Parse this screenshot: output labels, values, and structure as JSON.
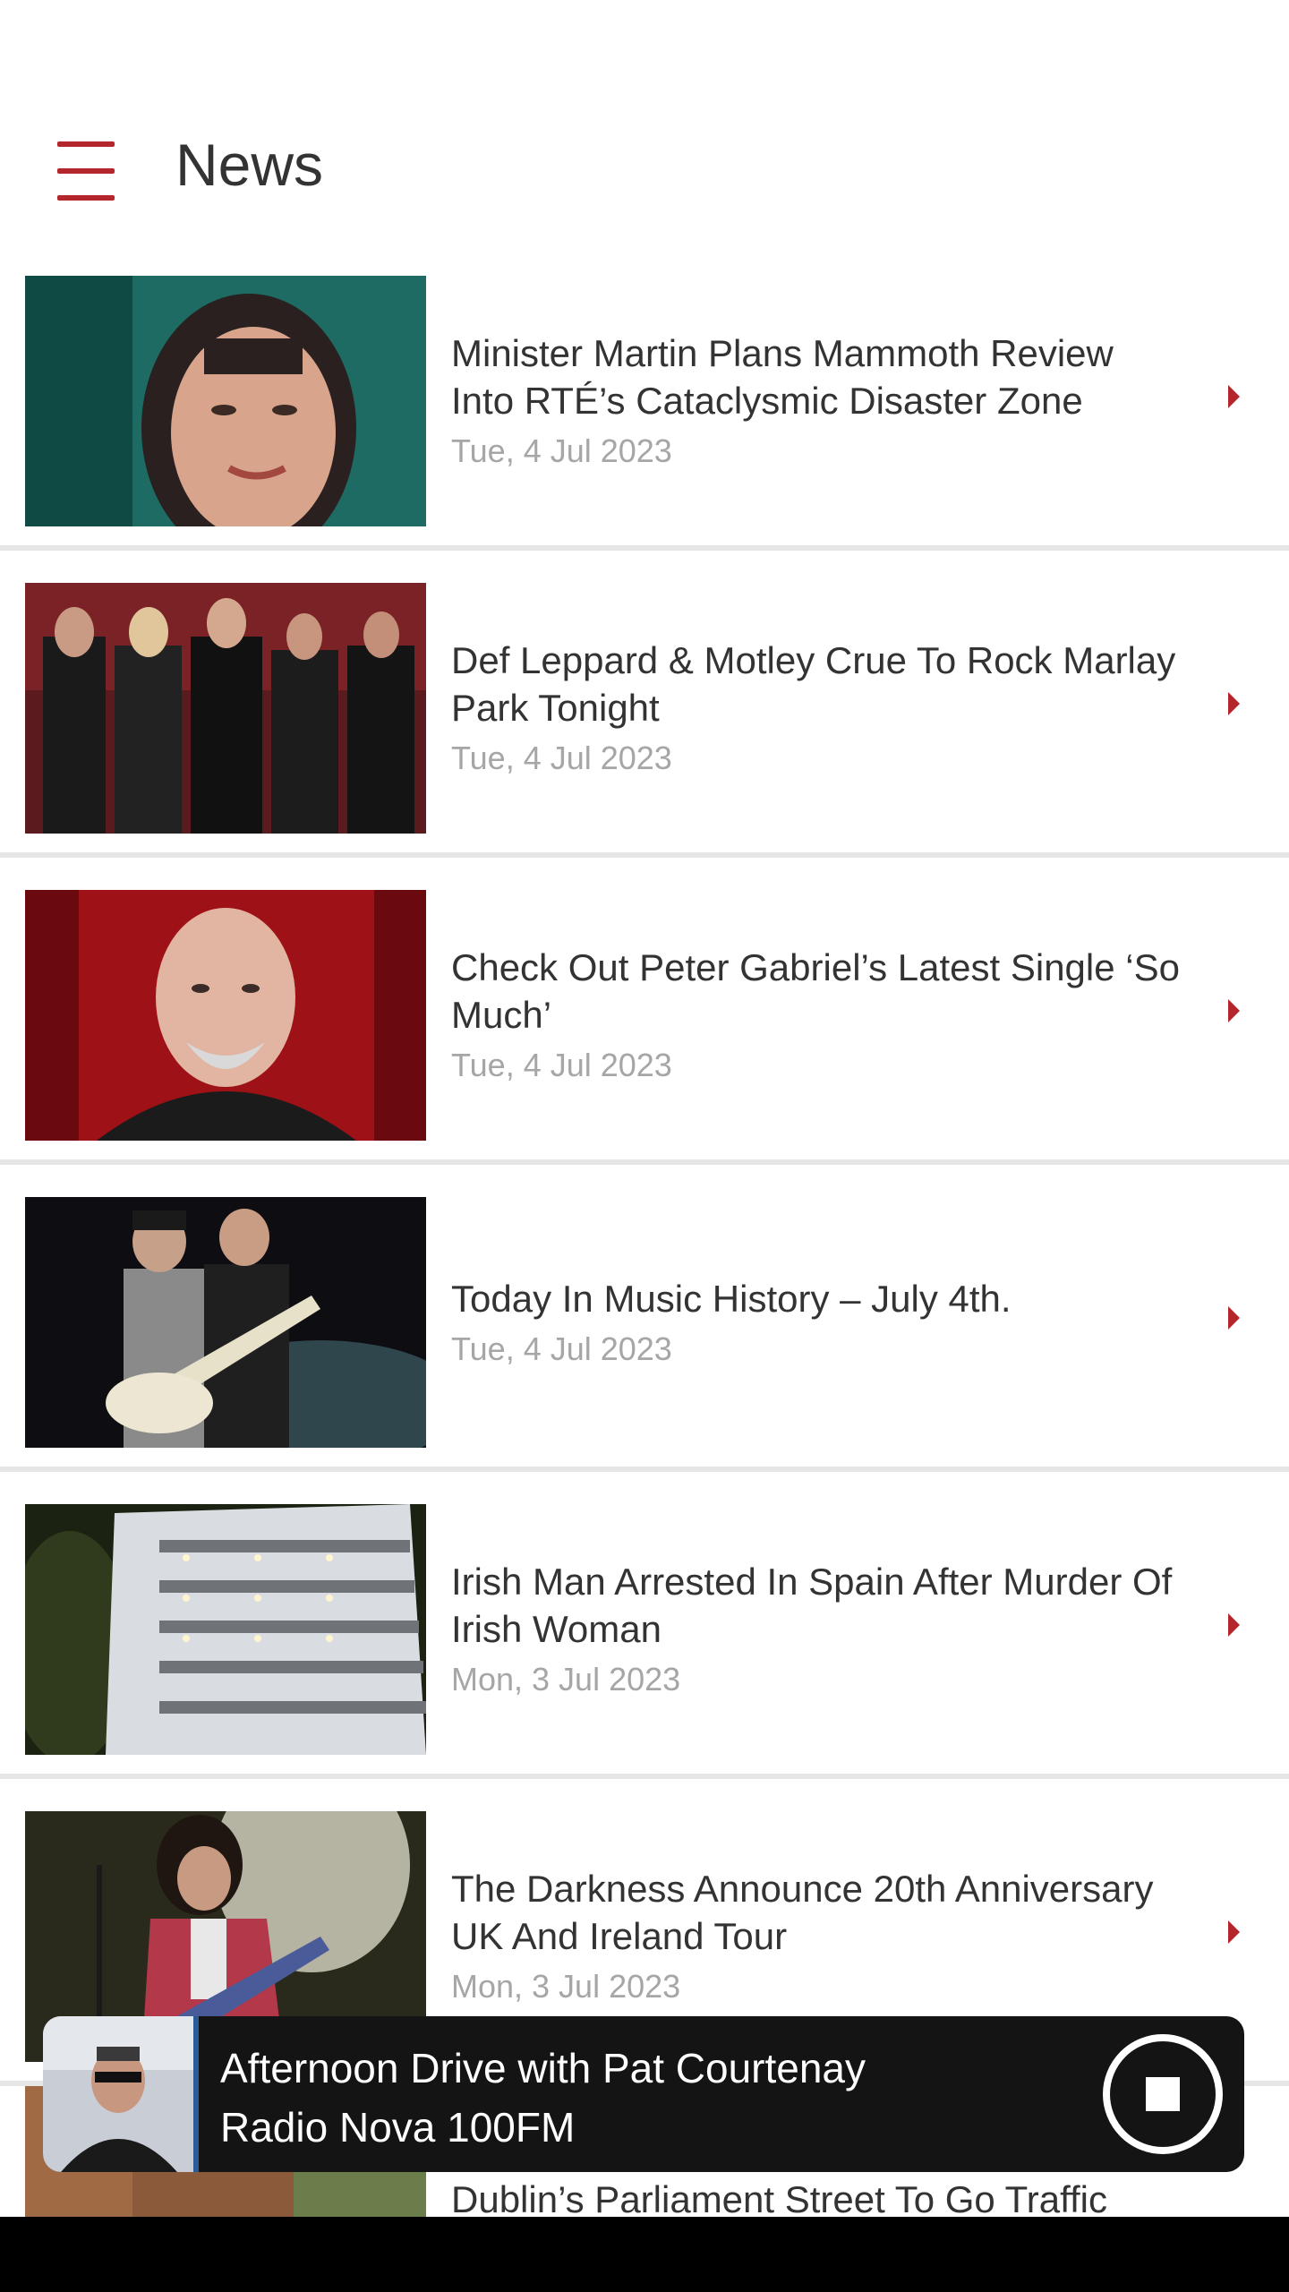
{
  "header": {
    "title": "News",
    "menu_icon": "hamburger-menu-icon"
  },
  "colors": {
    "accent": "#b3262b",
    "headline": "#333333",
    "date": "#a6a6a6",
    "divider": "#e6e6e6",
    "player_bg": "#141414"
  },
  "news": [
    {
      "headline": "Minister Martin Plans Mammoth Review Into RTÉ’s Cataclysmic Disaster Zone",
      "date": "Tue, 4 Jul 2023"
    },
    {
      "headline": "Def Leppard & Motley Crue To Rock Marlay Park Tonight",
      "date": "Tue, 4 Jul 2023"
    },
    {
      "headline": "Check Out Peter Gabriel’s Latest Single ‘So Much’",
      "date": "Tue, 4 Jul 2023"
    },
    {
      "headline": "Today In Music History – July 4th.",
      "date": "Tue, 4 Jul 2023"
    },
    {
      "headline": "Irish Man Arrested In Spain After Murder Of Irish Woman",
      "date": "Mon, 3 Jul 2023"
    },
    {
      "headline": "The Darkness Announce 20th Anniversary UK And Ireland Tour",
      "date": "Mon, 3 Jul 2023"
    },
    {
      "headline": "Dublin’s Parliament Street To Go Traffic"
    }
  ],
  "player": {
    "show": "Afternoon Drive with Pat Courtenay",
    "station": "Radio Nova 100FM",
    "stop_icon": "stop-icon"
  }
}
